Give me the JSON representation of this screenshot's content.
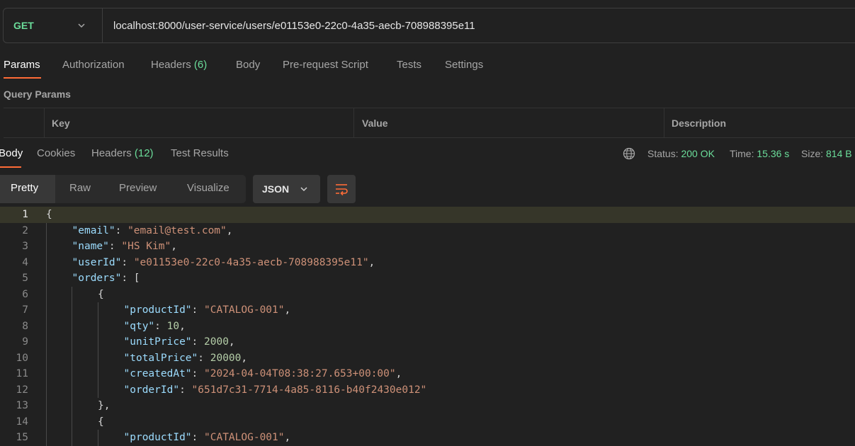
{
  "request": {
    "method": "GET",
    "url": "localhost:8000/user-service/users/e01153e0-22c0-4a35-aecb-708988395e11"
  },
  "request_tabs": [
    {
      "label": "Params",
      "count": ""
    },
    {
      "label": "Authorization",
      "count": ""
    },
    {
      "label": "Headers",
      "count": "(6)"
    },
    {
      "label": "Body",
      "count": ""
    },
    {
      "label": "Pre-request Script",
      "count": ""
    },
    {
      "label": "Tests",
      "count": ""
    },
    {
      "label": "Settings",
      "count": ""
    }
  ],
  "query_params": {
    "title": "Query Params",
    "columns": [
      "Key",
      "Value",
      "Description"
    ]
  },
  "response_tabs": [
    {
      "label": "Body",
      "count": ""
    },
    {
      "label": "Cookies",
      "count": ""
    },
    {
      "label": "Headers",
      "count": "(12)"
    },
    {
      "label": "Test Results",
      "count": ""
    }
  ],
  "response_status": {
    "status_label": "Status:",
    "status_value": "200 OK",
    "time_label": "Time:",
    "time_value": "15.36 s",
    "size_label": "Size:",
    "size_value": "814 B"
  },
  "view_modes": [
    "Pretty",
    "Raw",
    "Preview",
    "Visualize"
  ],
  "format": "JSON",
  "icons": {
    "method_chevron": "chevron-down-icon",
    "globe": "globe-icon",
    "format_chevron": "chevron-down-icon",
    "wrap": "wrap-lines-icon"
  },
  "colors": {
    "accent": "#ff6c37",
    "success": "#6bdd9a",
    "key": "#9cdcfe",
    "string": "#ce9178",
    "number": "#b5cea8"
  },
  "code_lines": [
    {
      "no": "1",
      "indent": 0,
      "parts": [
        [
          "p",
          "{"
        ]
      ]
    },
    {
      "no": "2",
      "indent": 1,
      "parts": [
        [
          "k",
          "\"email\""
        ],
        [
          "p",
          ": "
        ],
        [
          "s",
          "\"email@test.com\""
        ],
        [
          "p",
          ","
        ]
      ]
    },
    {
      "no": "3",
      "indent": 1,
      "parts": [
        [
          "k",
          "\"name\""
        ],
        [
          "p",
          ": "
        ],
        [
          "s",
          "\"HS Kim\""
        ],
        [
          "p",
          ","
        ]
      ]
    },
    {
      "no": "4",
      "indent": 1,
      "parts": [
        [
          "k",
          "\"userId\""
        ],
        [
          "p",
          ": "
        ],
        [
          "s",
          "\"e01153e0-22c0-4a35-aecb-708988395e11\""
        ],
        [
          "p",
          ","
        ]
      ]
    },
    {
      "no": "5",
      "indent": 1,
      "parts": [
        [
          "k",
          "\"orders\""
        ],
        [
          "p",
          ": ["
        ]
      ]
    },
    {
      "no": "6",
      "indent": 2,
      "parts": [
        [
          "p",
          "{"
        ]
      ]
    },
    {
      "no": "7",
      "indent": 3,
      "parts": [
        [
          "k",
          "\"productId\""
        ],
        [
          "p",
          ": "
        ],
        [
          "s",
          "\"CATALOG-001\""
        ],
        [
          "p",
          ","
        ]
      ]
    },
    {
      "no": "8",
      "indent": 3,
      "parts": [
        [
          "k",
          "\"qty\""
        ],
        [
          "p",
          ": "
        ],
        [
          "n",
          "10"
        ],
        [
          "p",
          ","
        ]
      ]
    },
    {
      "no": "9",
      "indent": 3,
      "parts": [
        [
          "k",
          "\"unitPrice\""
        ],
        [
          "p",
          ": "
        ],
        [
          "n",
          "2000"
        ],
        [
          "p",
          ","
        ]
      ]
    },
    {
      "no": "10",
      "indent": 3,
      "parts": [
        [
          "k",
          "\"totalPrice\""
        ],
        [
          "p",
          ": "
        ],
        [
          "n",
          "20000"
        ],
        [
          "p",
          ","
        ]
      ]
    },
    {
      "no": "11",
      "indent": 3,
      "parts": [
        [
          "k",
          "\"createdAt\""
        ],
        [
          "p",
          ": "
        ],
        [
          "s",
          "\"2024-04-04T08:38:27.653+00:00\""
        ],
        [
          "p",
          ","
        ]
      ]
    },
    {
      "no": "12",
      "indent": 3,
      "parts": [
        [
          "k",
          "\"orderId\""
        ],
        [
          "p",
          ": "
        ],
        [
          "s",
          "\"651d7c31-7714-4a85-8116-b40f2430e012\""
        ]
      ]
    },
    {
      "no": "13",
      "indent": 2,
      "parts": [
        [
          "p",
          "},"
        ]
      ]
    },
    {
      "no": "14",
      "indent": 2,
      "parts": [
        [
          "p",
          "{"
        ]
      ]
    },
    {
      "no": "15",
      "indent": 3,
      "parts": [
        [
          "k",
          "\"productId\""
        ],
        [
          "p",
          ": "
        ],
        [
          "s",
          "\"CATALOG-001\""
        ],
        [
          "p",
          ","
        ]
      ]
    }
  ]
}
